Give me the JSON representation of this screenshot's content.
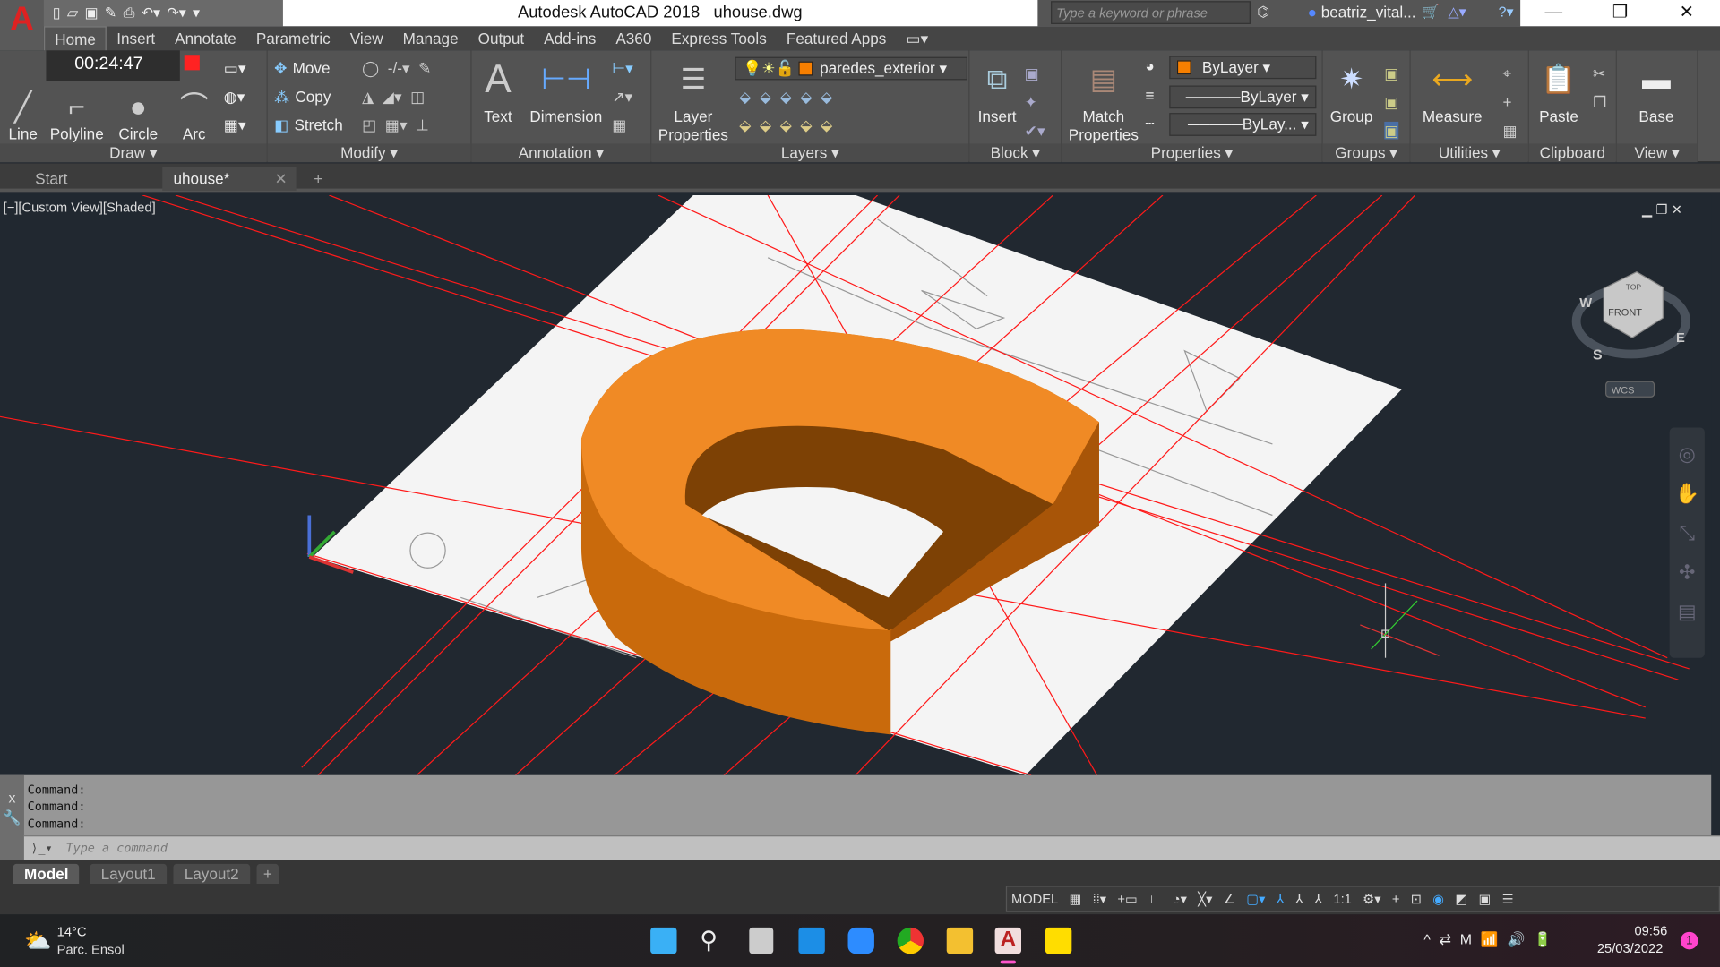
{
  "app": {
    "logo": "A",
    "title": "Autodesk AutoCAD 2018",
    "filename": "uhouse.dwg"
  },
  "qat": {
    "icons": [
      "new-icon",
      "open-icon",
      "save-icon",
      "save-as-icon",
      "plot-icon",
      "undo-icon",
      "redo-icon",
      "customize-icon"
    ]
  },
  "search": {
    "placeholder": "Type a keyword or phrase"
  },
  "user": {
    "name": "beatriz_vital..."
  },
  "window": {
    "minimize": "—",
    "restore": "❐",
    "close": "✕"
  },
  "ribbon_tabs": [
    "Home",
    "Insert",
    "Annotate",
    "Parametric",
    "View",
    "Manage",
    "Output",
    "Add-ins",
    "A360",
    "Express Tools",
    "Featured Apps"
  ],
  "recorder": {
    "time": "00:24:47"
  },
  "panels": {
    "draw": {
      "title": "Draw",
      "line": "Line",
      "polyline": "Polyline",
      "circle": "Circle",
      "arc": "Arc"
    },
    "modify": {
      "title": "Modify",
      "move": "Move",
      "copy": "Copy",
      "stretch": "Stretch"
    },
    "annotation": {
      "title": "Annotation",
      "text": "Text",
      "dimension": "Dimension"
    },
    "layers": {
      "title": "Layers",
      "layer_properties": "Layer Properties",
      "current_layer": "paredes_exterior"
    },
    "block": {
      "title": "Block",
      "insert": "Insert"
    },
    "properties": {
      "title": "Properties",
      "match": "Match Properties",
      "color": "ByLayer",
      "lineweight": "ByLayer",
      "linetype": "ByLay..."
    },
    "groups": {
      "title": "Groups",
      "group": "Group"
    },
    "utilities": {
      "title": "Utilities",
      "measure": "Measure"
    },
    "clipboard": {
      "title": "Clipboard",
      "paste": "Paste"
    },
    "view": {
      "title": "View",
      "base": "Base"
    }
  },
  "doc_tabs": [
    {
      "label": "Start"
    },
    {
      "label": "uhouse*"
    }
  ],
  "viewport": {
    "label": "[−][Custom View][Shaded]",
    "navcube": {
      "top": "TOP",
      "front": "FRONT",
      "w": "W",
      "s": "S",
      "e": "E",
      "wcs": "WCS"
    }
  },
  "command": {
    "history": [
      "Command:",
      "Command:",
      "Command:"
    ],
    "placeholder": "Type a command"
  },
  "layout_tabs": [
    "Model",
    "Layout1",
    "Layout2"
  ],
  "status": {
    "model": "MODEL",
    "scale": "1:1"
  },
  "taskbar": {
    "temp": "14°C",
    "weather": "Parc. Ensol",
    "time": "09:56",
    "date": "25/03/2022",
    "notifications": "1"
  },
  "colors": {
    "accent_orange": "#f77f00",
    "red_lines": "#ff0000",
    "viewport_bg": "#212830"
  }
}
